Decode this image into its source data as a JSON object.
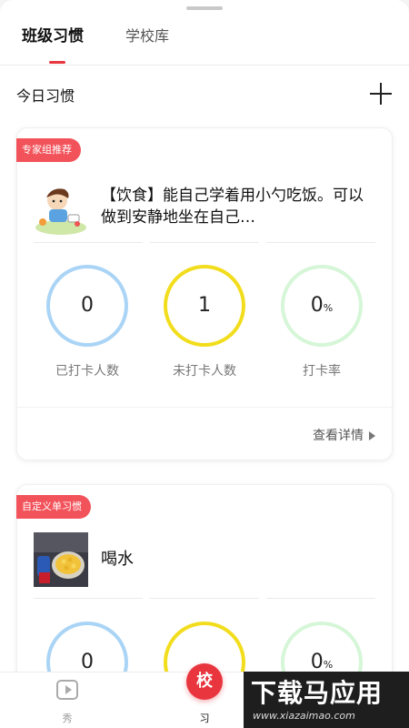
{
  "tabs": [
    {
      "label": "班级习惯",
      "active": true
    },
    {
      "label": "学校库",
      "active": false
    }
  ],
  "section": {
    "title": "今日习惯",
    "add_icon": "plus-icon"
  },
  "cards": [
    {
      "badge": "专家组推荐",
      "title": "【饮食】能自己学着用小勺吃饭。可以做到安静地坐在自己…",
      "thumb": "cartoon-child-eating",
      "stats": [
        {
          "value": "0",
          "unit": "",
          "label": "已打卡人数"
        },
        {
          "value": "1",
          "unit": "",
          "label": "未打卡人数"
        },
        {
          "value": "0",
          "unit": "%",
          "label": "打卡率"
        }
      ],
      "detail_link": "查看详情"
    },
    {
      "badge": "自定义单习惯",
      "title": "喝水",
      "thumb": "photo-cereal-bowl",
      "stats": [
        {
          "value": "0",
          "unit": "",
          "label": ""
        },
        {
          "value": "",
          "unit": "",
          "label": ""
        },
        {
          "value": "0",
          "unit": "%",
          "label": ""
        }
      ]
    }
  ],
  "bottom_nav": {
    "items": [
      {
        "label": "秀",
        "icon": "play-icon"
      },
      {
        "label": "习",
        "icon": "school-icon",
        "center_text": "校"
      }
    ]
  },
  "watermark": {
    "main": "下载马应用",
    "sub": "www.xiazaimao.com"
  },
  "colors": {
    "accent": "#e8353e",
    "badge": "#f2535b",
    "ring_blue": "#aad4f5",
    "ring_yellow": "#f2dd1d",
    "ring_green": "#d6f6d8"
  }
}
